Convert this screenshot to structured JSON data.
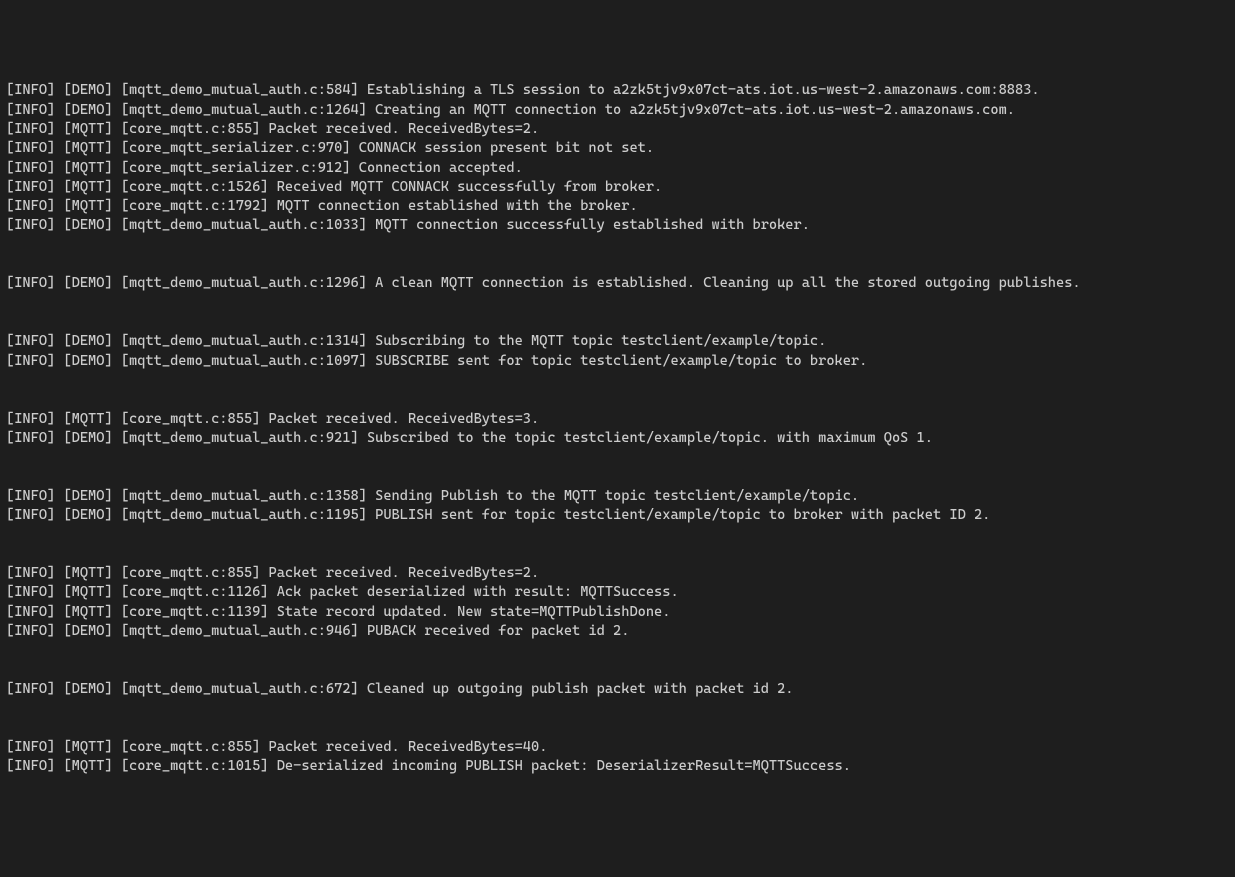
{
  "log_entries": [
    {
      "level": "INFO",
      "category": "DEMO",
      "source": "mqtt_demo_mutual_auth.c:584",
      "message": "Establishing a TLS session to a2zk5tjv9x07ct-ats.iot.us-west-2.amazonaws.com:8883."
    },
    {
      "level": "INFO",
      "category": "DEMO",
      "source": "mqtt_demo_mutual_auth.c:1264",
      "message": "Creating an MQTT connection to a2zk5tjv9x07ct-ats.iot.us-west-2.amazonaws.com."
    },
    {
      "level": "INFO",
      "category": "MQTT",
      "source": "core_mqtt.c:855",
      "message": "Packet received. ReceivedBytes=2."
    },
    {
      "level": "INFO",
      "category": "MQTT",
      "source": "core_mqtt_serializer.c:970",
      "message": "CONNACK session present bit not set."
    },
    {
      "level": "INFO",
      "category": "MQTT",
      "source": "core_mqtt_serializer.c:912",
      "message": "Connection accepted."
    },
    {
      "level": "INFO",
      "category": "MQTT",
      "source": "core_mqtt.c:1526",
      "message": "Received MQTT CONNACK successfully from broker."
    },
    {
      "level": "INFO",
      "category": "MQTT",
      "source": "core_mqtt.c:1792",
      "message": "MQTT connection established with the broker."
    },
    {
      "level": "INFO",
      "category": "DEMO",
      "source": "mqtt_demo_mutual_auth.c:1033",
      "message": "MQTT connection successfully established with broker."
    },
    {
      "blank": true
    },
    {
      "blank": true
    },
    {
      "level": "INFO",
      "category": "DEMO",
      "source": "mqtt_demo_mutual_auth.c:1296",
      "message": "A clean MQTT connection is established. Cleaning up all the stored outgoing publishes."
    },
    {
      "blank": true
    },
    {
      "blank": true
    },
    {
      "level": "INFO",
      "category": "DEMO",
      "source": "mqtt_demo_mutual_auth.c:1314",
      "message": "Subscribing to the MQTT topic testclient/example/topic."
    },
    {
      "level": "INFO",
      "category": "DEMO",
      "source": "mqtt_demo_mutual_auth.c:1097",
      "message": "SUBSCRIBE sent for topic testclient/example/topic to broker."
    },
    {
      "blank": true
    },
    {
      "blank": true
    },
    {
      "level": "INFO",
      "category": "MQTT",
      "source": "core_mqtt.c:855",
      "message": "Packet received. ReceivedBytes=3."
    },
    {
      "level": "INFO",
      "category": "DEMO",
      "source": "mqtt_demo_mutual_auth.c:921",
      "message": "Subscribed to the topic testclient/example/topic. with maximum QoS 1."
    },
    {
      "blank": true
    },
    {
      "blank": true
    },
    {
      "level": "INFO",
      "category": "DEMO",
      "source": "mqtt_demo_mutual_auth.c:1358",
      "message": "Sending Publish to the MQTT topic testclient/example/topic."
    },
    {
      "level": "INFO",
      "category": "DEMO",
      "source": "mqtt_demo_mutual_auth.c:1195",
      "message": "PUBLISH sent for topic testclient/example/topic to broker with packet ID 2."
    },
    {
      "blank": true
    },
    {
      "blank": true
    },
    {
      "level": "INFO",
      "category": "MQTT",
      "source": "core_mqtt.c:855",
      "message": "Packet received. ReceivedBytes=2."
    },
    {
      "level": "INFO",
      "category": "MQTT",
      "source": "core_mqtt.c:1126",
      "message": "Ack packet deserialized with result: MQTTSuccess."
    },
    {
      "level": "INFO",
      "category": "MQTT",
      "source": "core_mqtt.c:1139",
      "message": "State record updated. New state=MQTTPublishDone."
    },
    {
      "level": "INFO",
      "category": "DEMO",
      "source": "mqtt_demo_mutual_auth.c:946",
      "message": "PUBACK received for packet id 2."
    },
    {
      "blank": true
    },
    {
      "blank": true
    },
    {
      "level": "INFO",
      "category": "DEMO",
      "source": "mqtt_demo_mutual_auth.c:672",
      "message": "Cleaned up outgoing publish packet with packet id 2."
    },
    {
      "blank": true
    },
    {
      "blank": true
    },
    {
      "level": "INFO",
      "category": "MQTT",
      "source": "core_mqtt.c:855",
      "message": "Packet received. ReceivedBytes=40."
    },
    {
      "level": "INFO",
      "category": "MQTT",
      "source": "core_mqtt.c:1015",
      "message": "De-serialized incoming PUBLISH packet: DeserializerResult=MQTTSuccess."
    }
  ]
}
